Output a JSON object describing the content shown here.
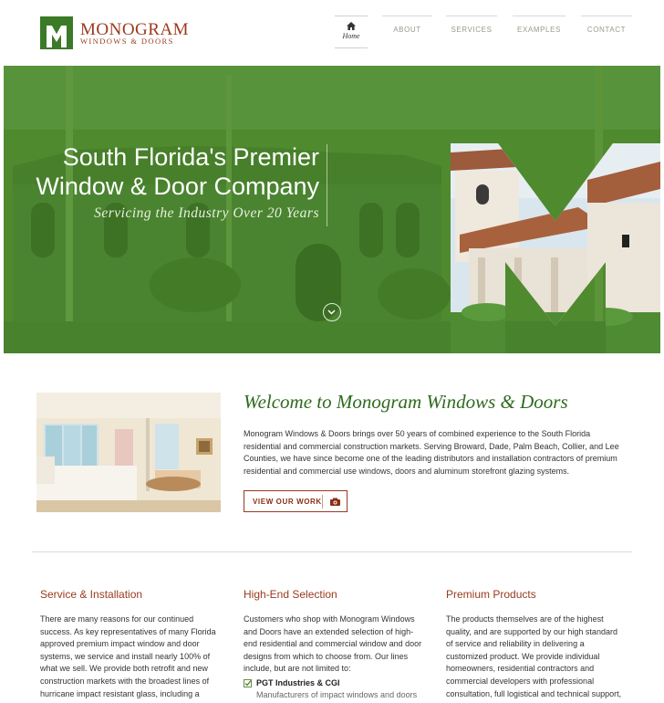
{
  "brand": {
    "name": "MONOGRAM",
    "tagline": "WINDOWS & DOORS",
    "colors": {
      "green": "#4e8a2c",
      "rust": "#9a3a1e",
      "dark_green": "#2f6a1e"
    }
  },
  "nav": {
    "items": [
      {
        "label": "Home",
        "icon": "home-icon",
        "active": true
      },
      {
        "label": "ABOUT"
      },
      {
        "label": "SERVICES"
      },
      {
        "label": "EXAMPLES"
      },
      {
        "label": "CONTACT"
      }
    ]
  },
  "hero": {
    "title_line1": "South Florida's Premier",
    "title_line2": "Window & Door Company",
    "subtitle": "Servicing the Industry Over 20 Years",
    "scroll_icon": "chevron-down-icon"
  },
  "welcome": {
    "title": "Welcome to Monogram Windows & Doors",
    "body": "Monogram Windows & Doors brings over 50 years of combined experience to the South Florida residential and commercial construction markets. Serving Broward, Dade, Palm Beach, Collier, and Lee Counties, we have since become one of the leading distributors and installation contractors of premium residential and commercial use windows, doors and aluminum storefront glazing systems.",
    "button_label": "VIEW OUR WORK",
    "button_icon": "camera-icon"
  },
  "columns": [
    {
      "title": "Service & Installation",
      "body": "There are many reasons for our continued success. As key representatives of many Florida approved premium impact window and door systems, we service and install nearly 100% of what we sell. We provide both retrofit and new construction markets with the broadest lines of hurricane impact resistant glass, including a"
    },
    {
      "title": "High-End Selection",
      "body": "Customers who shop with Monogram Windows and Doors have an extended selection of high-end residential and commercial window and door designs from which to choose from. Our lines include, but are not limited to:",
      "list": [
        {
          "title": "PGT Industries & CGI",
          "desc": "Manufacturers of impact windows and doors"
        }
      ]
    },
    {
      "title": "Premium Products",
      "body": "The products themselves are of the highest quality, and are supported by our high standard of service and reliability in delivering a customized product. We provide individual homeowners, residential contractors and commercial developers with professional consultation, full logistical and technical support,"
    }
  ]
}
